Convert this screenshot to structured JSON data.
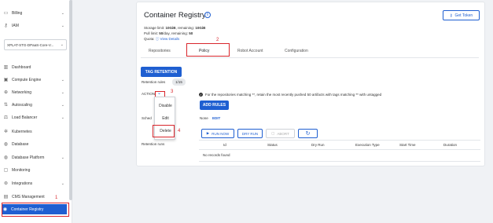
{
  "sidebar": {
    "items": [
      {
        "label": "Billing",
        "icon": "wallet-icon",
        "chevron": true
      },
      {
        "label": "IAM",
        "icon": "key-icon",
        "chevron": true
      },
      {
        "label": "Dashboard",
        "icon": "chart-icon",
        "chevron": false
      },
      {
        "label": "Compute Engine",
        "icon": "chip-icon",
        "chevron": true
      },
      {
        "label": "Networking",
        "icon": "network-icon",
        "chevron": true
      },
      {
        "label": "Autoscaling",
        "icon": "scale-icon",
        "chevron": true
      },
      {
        "label": "Load Balancer",
        "icon": "balance-icon",
        "chevron": true
      },
      {
        "label": "Kubernetes",
        "icon": "helm-icon",
        "chevron": false
      },
      {
        "label": "Database",
        "icon": "database-icon",
        "chevron": false
      },
      {
        "label": "Database Platform",
        "icon": "database-platform-icon",
        "chevron": true
      },
      {
        "label": "Monitoring",
        "icon": "monitor-icon",
        "chevron": false
      },
      {
        "label": "Integrations",
        "icon": "plug-icon",
        "chevron": true
      },
      {
        "label": "CMS Management",
        "icon": "cms-icon",
        "chevron": false
      },
      {
        "label": "Container Registry",
        "icon": "registry-icon",
        "chevron": false,
        "active": true
      }
    ],
    "project": "XPLAT-STG-DPaaS-Core-V...",
    "annotation": "1"
  },
  "page": {
    "title": "Container Registry",
    "get_token": "Get Token",
    "storage_limit_label": "Storage limit:",
    "storage_limit_value": "10GiB",
    "storage_remaining_label": ", remaining:",
    "storage_remaining_value": "10GiB",
    "pull_limit_label": "Pull limit:",
    "pull_limit_value": "50",
    "pull_limit_unit": "/day, remaining:",
    "pull_remaining_value": "50",
    "quota_label": "Quota:",
    "view_details": "View Details"
  },
  "tabs": [
    "Repositories",
    "Policy",
    "Robot Account",
    "Configuration"
  ],
  "tab_annotation": "2",
  "policy": {
    "tag_retention": "TAG RETENTION",
    "retention_rules_label": "Retention rules",
    "retention_rules_count": "1/15",
    "action_label": "ACTION",
    "action_annotation": "3",
    "rule_text": "For the repositories matching **, retain the most recently pushed 50 artifacts with tags matching ** with untagged",
    "add_rules": "ADD RULES",
    "schedule_label": "Sched",
    "schedule_value": "None",
    "schedule_edit": "EDIT",
    "retention_runs_label": "Retention runs",
    "run_now": "RUN NOW",
    "dry_run": "DRY RUN",
    "abort": "ABORT",
    "menu": [
      "Disable",
      "Edit",
      "Delete"
    ],
    "delete_annotation": "4",
    "columns": [
      "Id",
      "Status",
      "Dry Run",
      "Execution Type",
      "Start Time",
      "Duration"
    ],
    "empty": "No records found"
  },
  "colors": {
    "accent": "#1f5fd1",
    "annotation": "#d9262c"
  }
}
